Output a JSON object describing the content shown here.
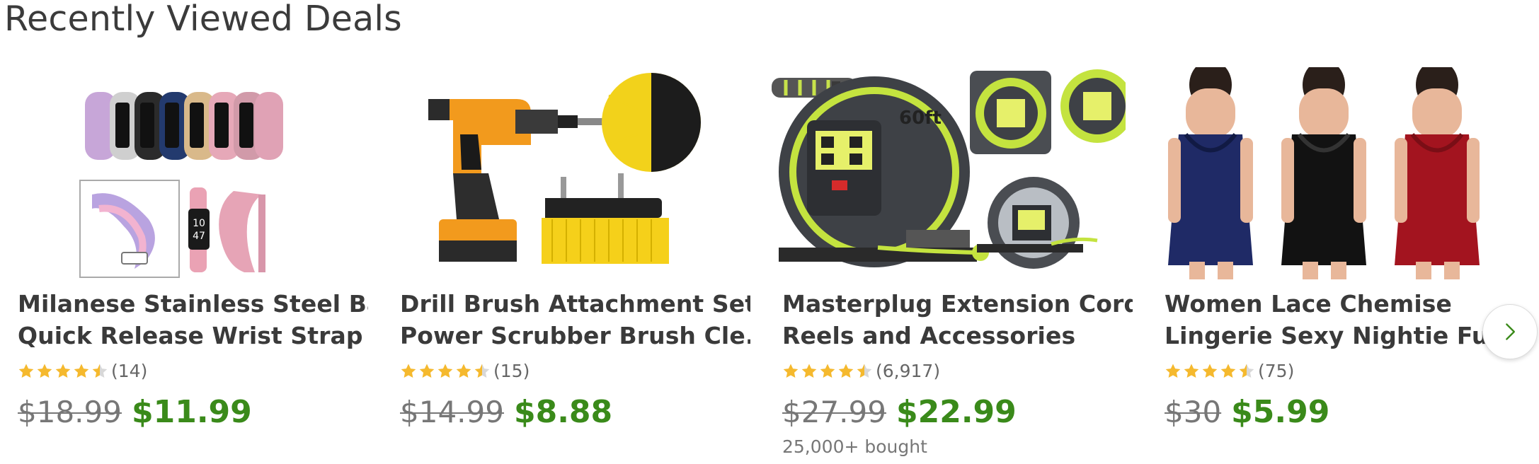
{
  "section": {
    "title": "Recently Viewed Deals"
  },
  "deals": [
    {
      "title_line1": "Milanese Stainless Steel Band",
      "title_line2": "Quick Release Wrist Strap F...",
      "rating": 4.5,
      "rating_count": "(14)",
      "price_old": "$18.99",
      "price_new": "$11.99",
      "bought": "",
      "image_alt": "watch-bands-product-image"
    },
    {
      "title_line1": "Drill Brush Attachment Set -",
      "title_line2": "Power Scrubber Brush Cle...",
      "rating": 4.5,
      "rating_count": "(15)",
      "price_old": "$14.99",
      "price_new": "$8.88",
      "bought": "",
      "image_alt": "drill-brush-product-image"
    },
    {
      "title_line1": "Masterplug Extension Cord",
      "title_line2": "Reels and Accessories",
      "rating": 4.5,
      "rating_count": "(6,917)",
      "price_old": "$27.99",
      "price_new": "$22.99",
      "bought": "25,000+ bought",
      "image_alt": "cord-reel-product-image"
    },
    {
      "title_line1": "Women Lace Chemise",
      "title_line2": "Lingerie Sexy Nightie Full Sl...",
      "rating": 4.5,
      "rating_count": "(75)",
      "price_old": "$30",
      "price_new": "$5.99",
      "bought": "",
      "image_alt": "chemise-product-image"
    }
  ],
  "colors": {
    "star": "#f5b92e",
    "star_empty": "#d8d8d8",
    "price_new": "#3a8a1a",
    "price_old": "#777777"
  },
  "icons": {
    "next": "chevron-right-icon",
    "star": "star-icon"
  }
}
